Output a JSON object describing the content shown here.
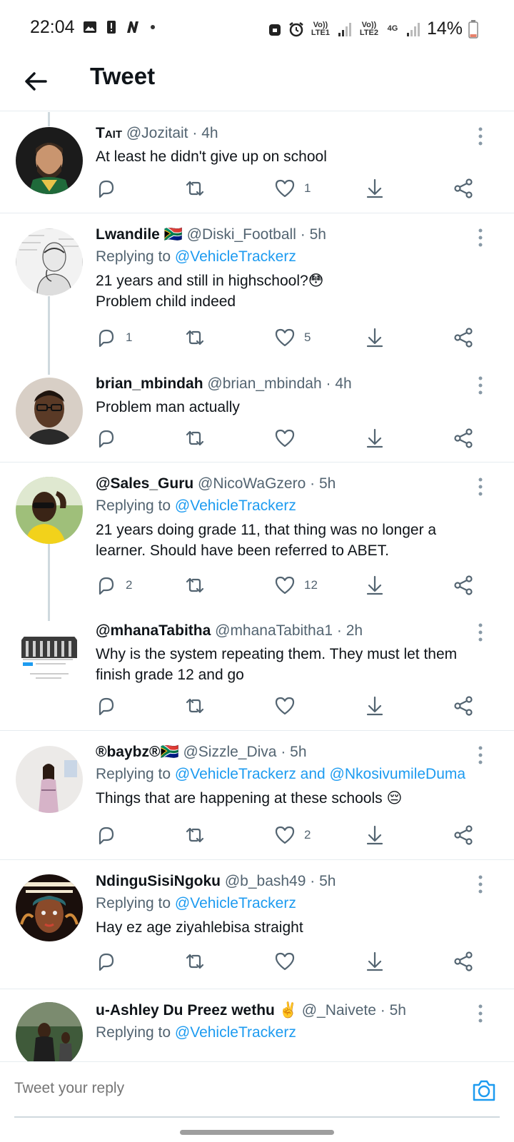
{
  "status_bar": {
    "time": "22:04",
    "sim1_label": "Vo)) LTE1",
    "sim2_label": "Vo)) LTE2",
    "net_type": "4G",
    "battery": "14%"
  },
  "header": {
    "title": "Tweet"
  },
  "tweets": [
    {
      "name": "Tait",
      "handle": "@Jozitait",
      "time": "4h",
      "replying_to": "",
      "text": "At least he didn't give up on school",
      "replies": "",
      "retweets": "",
      "likes": "1"
    },
    {
      "name": "Lwandile 🇿🇦",
      "handle": "@Diski_Football",
      "time": "5h",
      "replying_prefix": "Replying to",
      "replying_to": "@VehicleTrackerz",
      "text": "21 years and still in highschool?😳",
      "text2": "Problem child indeed",
      "replies": "1",
      "retweets": "",
      "likes": "5"
    },
    {
      "name": "brian_mbindah",
      "handle": "@brian_mbindah",
      "time": "4h",
      "text": "Problem man actually",
      "replies": "",
      "retweets": "",
      "likes": ""
    },
    {
      "name": "@Sales_Guru",
      "handle": "@NicoWaGzero",
      "time": "5h",
      "replying_prefix": "Replying to",
      "replying_to": "@VehicleTrackerz",
      "text": "21 years doing grade 11, that thing was no longer a",
      "text2": "learner. Should have been referred to ABET.",
      "replies": "2",
      "retweets": "",
      "likes": "12"
    },
    {
      "name": "@mhanaTabitha",
      "handle": "@mhanaTabitha1",
      "time": "2h",
      "text": "Why is the system repeating them. They must let them",
      "text2": "finish grade 12 and go",
      "replies": "",
      "retweets": "",
      "likes": ""
    },
    {
      "name": "®baybz®🇿🇦",
      "handle": "@Sizzle_Diva",
      "time": "5h",
      "replying_prefix": "Replying to",
      "replying_to": "@VehicleTrackerz and @NkosivumileDuma",
      "text": "Things that are happening at these schools 😔",
      "replies": "",
      "retweets": "",
      "likes": "2"
    },
    {
      "name": "NdinguSisiNgoku",
      "handle": "@b_bash49",
      "time": "5h",
      "replying_prefix": "Replying to",
      "replying_to": "@VehicleTrackerz",
      "text": "Hay ez age ziyahlebisa straight",
      "replies": "",
      "retweets": "",
      "likes": ""
    },
    {
      "name": "u-Ashley Du Preez wethu ✌️",
      "handle": "@_Naivete",
      "time": "5h",
      "replying_prefix": "Replying to",
      "replying_to": "@VehicleTrackerz"
    }
  ],
  "separator_dot": "·",
  "reply_bar": {
    "placeholder": "Tweet your reply"
  },
  "colors": {
    "accent": "#1d9bf0",
    "secondary_text": "#536471",
    "divider": "#e6ecf0"
  },
  "icons": [
    "back-arrow-icon",
    "reply-icon",
    "retweet-icon",
    "heart-icon",
    "download-icon",
    "share-icon",
    "more-vertical-icon",
    "camera-icon"
  ]
}
